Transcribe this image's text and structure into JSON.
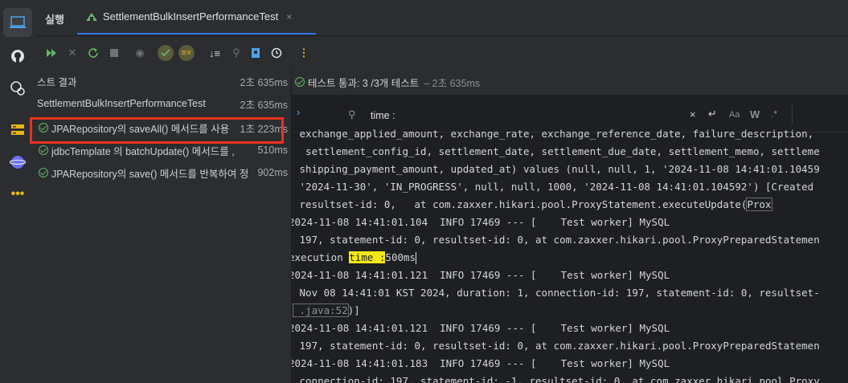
{
  "tabbar": {
    "run_label": "실행",
    "test_tab_label": "SettlementBulkInsertPerformanceTest",
    "close": "×"
  },
  "toolbar": {
    "icons": [
      "rerun-all-icon",
      "stop-debug-icon",
      "rerun-icon",
      "stop-icon",
      "eye-icon",
      "show-passed-icon",
      "show-ignored-icon",
      "sort-icon",
      "pin-icon",
      "export-icon",
      "history-icon",
      "more-icon"
    ]
  },
  "tree": {
    "root": {
      "label": "스트 결과",
      "duration": "2초 635ms"
    },
    "class": {
      "label": "SettlementBulkInsertPerformanceTest",
      "duration": "2초 635ms"
    },
    "items": [
      {
        "label": "JPARepository의 saveAll() 메서드를 사용",
        "duration": "1초 223ms"
      },
      {
        "label": "jdbcTemplate 의 batchUpdate() 메서드를 ,",
        "duration": "510ms"
      },
      {
        "label": "JPARepository의 save() 메서드를 반복하여 정",
        "duration": "902ms"
      }
    ]
  },
  "status": {
    "text": "테스트 통과: 3 /3개 테스트",
    "duration": "– 2초 635ms"
  },
  "search": {
    "value": "time :",
    "options": [
      "Aa",
      "W",
      ".*"
    ]
  },
  "console": {
    "lines": [
      " exchange_applied_amount, exchange_rate, exchange_reference_date, failure_description,",
      "  settlement_config_id, settlement_date, settlement_due_date, settlement_memo, settleme",
      " shipping_payment_amount, updated_at) values (null, null, 1, '2024-11-08 14:41:01.10459",
      " '2024-11-30', 'IN_PROGRESS', null, null, 1000, '2024-11-08 14:41:01.104592') [Created",
      " resultset-id: 0,   at com.zaxxer.hikari.pool.ProxyStatement.executeUpdate(",
      "2024-11-08 14:41:01.104  INFO 17469 --- [    Test worker] MySQL",
      " 197, statement-id: 0, resultset-id: 0, at com.zaxxer.hikari.pool.ProxyPreparedStatemen",
      "execution ",
      "2024-11-08 14:41:01.121  INFO 17469 --- [    Test worker] MySQL",
      " Nov 08 14:41:01 KST 2024, duration: 1, connection-id: 197, statement-id: 0, resultset-",
      " .java:52",
      "2024-11-08 14:41:01.121  INFO 17469 --- [    Test worker] MySQL",
      " 197, statement-id: 0, resultset-id: 0, at com.zaxxer.hikari.pool.ProxyPreparedStatemen",
      "2024-11-08 14:41:01.183  INFO 17469 --- [    Test worker] MySQL",
      " connection-id: 197, statement-id: -1, resultset-id: 0, at com.zaxxer.hikari.pool.Proxy"
    ],
    "boxed_link": "Prox",
    "highlight": "time :",
    "after_highlight": "500ms",
    "line11_tail": ")]"
  },
  "colors": {
    "accent": "#3574f0",
    "pass": "#5fb865",
    "highlight": "#f2e816",
    "redbox": "#e8331e"
  }
}
